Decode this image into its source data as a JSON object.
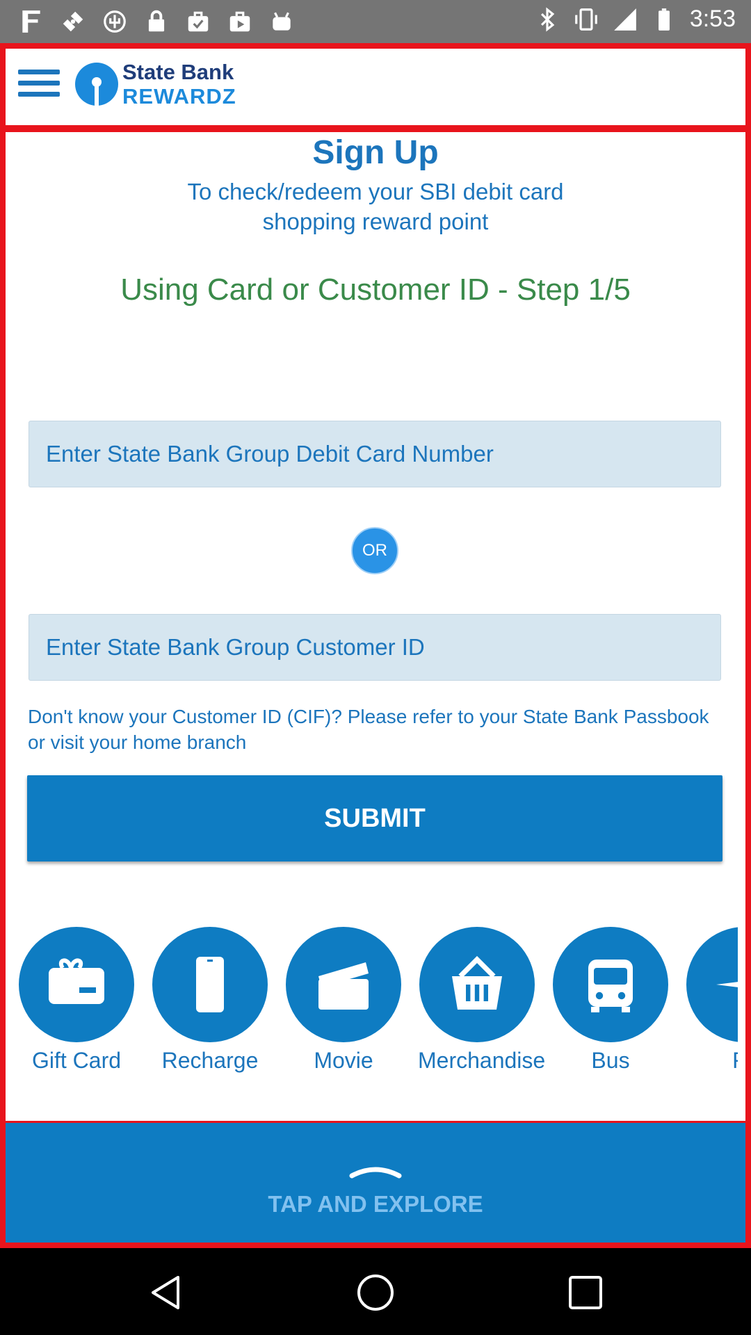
{
  "status_bar": {
    "time": "3:53",
    "left_icons": [
      "fake-app-icon",
      "satellite-icon",
      "usb-icon",
      "lock-icon",
      "check-bag-icon",
      "play-bag-icon",
      "android-icon"
    ],
    "right_icons": [
      "bluetooth-icon",
      "vibrate-icon",
      "signal-icon",
      "battery-icon"
    ]
  },
  "header": {
    "logo_line1": "State Bank",
    "logo_line2": "REWARDZ"
  },
  "signup": {
    "title": "Sign Up",
    "subtitle": "To check/redeem your SBI debit card shopping reward point",
    "step": "Using Card or Customer ID - Step 1/5",
    "card_placeholder": "Enter State Bank Group Debit Card Number",
    "or_label": "OR",
    "customer_placeholder": "Enter State Bank Group Customer ID",
    "hint": "Don't know your Customer ID (CIF)? Please refer to your State Bank Passbook or visit your home branch",
    "submit_label": "SUBMIT"
  },
  "categories": [
    {
      "label": "Gift Card",
      "icon": "gift-card-icon"
    },
    {
      "label": "Recharge",
      "icon": "phone-icon"
    },
    {
      "label": "Movie",
      "icon": "clapperboard-icon"
    },
    {
      "label": "Merchandise",
      "icon": "basket-icon"
    },
    {
      "label": "Bus",
      "icon": "bus-icon"
    },
    {
      "label": "Fli",
      "icon": "plane-icon"
    }
  ],
  "explore": {
    "label": "TAP AND EXPLORE"
  },
  "colors": {
    "brand_blue": "#0e7cc2",
    "frame_red": "#e8141c",
    "text_blue": "#1c75bc",
    "step_green": "#3a8a4a"
  }
}
